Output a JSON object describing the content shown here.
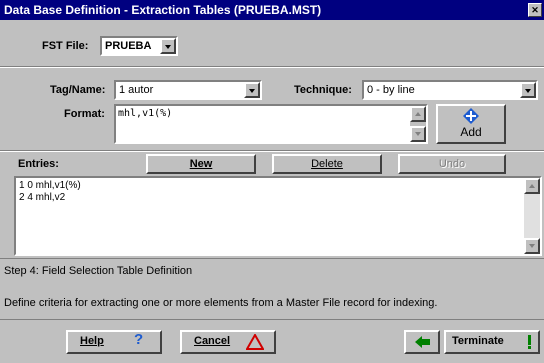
{
  "window": {
    "title": "Data Base Definition - Extraction Tables (PRUEBA.MST)"
  },
  "fst": {
    "label": "FST File:",
    "value": "PRUEBA"
  },
  "tag": {
    "label": "Tag/Name:",
    "value": "1 autor"
  },
  "technique": {
    "label": "Technique:",
    "value": "0 - by line"
  },
  "format": {
    "label": "Format:",
    "value": "mhl,v1(%)"
  },
  "add": {
    "label": "Add"
  },
  "entries": {
    "label": "Entries:",
    "new_label": "New",
    "delete_label": "Delete",
    "undo_label": "Undo",
    "items": [
      "1 0 mhl,v1(%)",
      "2 4 mhl,v2"
    ]
  },
  "status": {
    "step": "Step 4: Field Selection Table Definition",
    "description": "Define criteria for extracting one or more elements from a Master File record for indexing."
  },
  "footer": {
    "help_label": "Help",
    "cancel_label": "Cancel",
    "terminate_label": "Terminate"
  },
  "colors": {
    "titlebar": "#000080",
    "face": "#c0c0c0",
    "add_icon": "#1e5cd0",
    "cancel_icon": "#d00000",
    "back_arrow": "#008000"
  }
}
